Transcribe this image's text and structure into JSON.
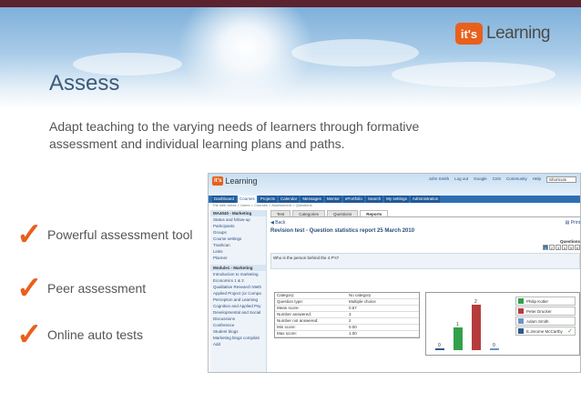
{
  "brand": {
    "badge": "it's",
    "word": "Learning"
  },
  "title": "Assess",
  "subtitle": "Adapt teaching to the varying needs of learners through formative assessment and individual learning plans and paths.",
  "bullets": [
    "Powerful assessment tool",
    "Peer assessment",
    "Online auto tests"
  ],
  "shot": {
    "logo_badge": "it's",
    "logo_word": "Learning",
    "user_links": [
      "John Smith",
      "Log out",
      "Google",
      "CSS",
      "Community",
      "Help"
    ],
    "shortcuts": "Shortcuts",
    "nav": [
      "Dashboard",
      "Courses",
      "Projects",
      "Calendar",
      "Messages",
      "Mentor",
      "ePortfolio",
      "Search",
      "My settings",
      "Administration"
    ],
    "crumb": "The web areas > Users > Courses > Assessment > Questions",
    "side_title": "MA4040 - Marketing",
    "side_items": [
      "Status and follow-up",
      "Participants",
      "Groups",
      "Course settings",
      "Trashcan",
      "Links",
      "Planner"
    ],
    "side_title2": "Module1 - Marketing",
    "side_items2": [
      "Introduction to marketing",
      "Economics 1 & 2",
      "Qualitative Research Meth",
      "Applied Project (or Compa",
      "Perception and Learning",
      "Cognition and Applied Psy",
      "Developmental and Social",
      "Discussions",
      "Conference",
      "Student blogs",
      "Marketing blogs compilati",
      "Add"
    ],
    "tabs": [
      "Test",
      "Categories",
      "Questions",
      "Reports"
    ],
    "back": "Back",
    "print": "Print",
    "report_title": "Revision test - Question statistics report 25 March 2010",
    "questions_label": "Questions",
    "pages": [
      "1",
      "2",
      "3",
      "4",
      "5",
      "6"
    ],
    "question_text": "Who is the person behind the 4 P's?",
    "stats": [
      [
        "Category:",
        "No category"
      ],
      [
        "Question type:",
        "Multiple choice"
      ],
      [
        "Mean score:",
        "0.67"
      ],
      [
        "Number answered:",
        "3"
      ],
      [
        "Number not answered:",
        "2"
      ],
      [
        "Min score:",
        "0.00"
      ],
      [
        "Max score:",
        "1.00"
      ]
    ],
    "legend": [
      {
        "label": "Philip Kotler",
        "color": "#33a04a"
      },
      {
        "label": "Peter Drucker",
        "color": "#b63c3c"
      },
      {
        "label": "Adam Smith",
        "color": "#6b95c8"
      },
      {
        "label": "E.Jerome McCarthy",
        "color": "#2d5a8c"
      }
    ],
    "answer_counts": [
      1,
      2,
      0,
      0
    ]
  },
  "colors": {
    "accent": "#e8601c",
    "title": "#3d5a7a",
    "stripe": "#5b2230"
  }
}
